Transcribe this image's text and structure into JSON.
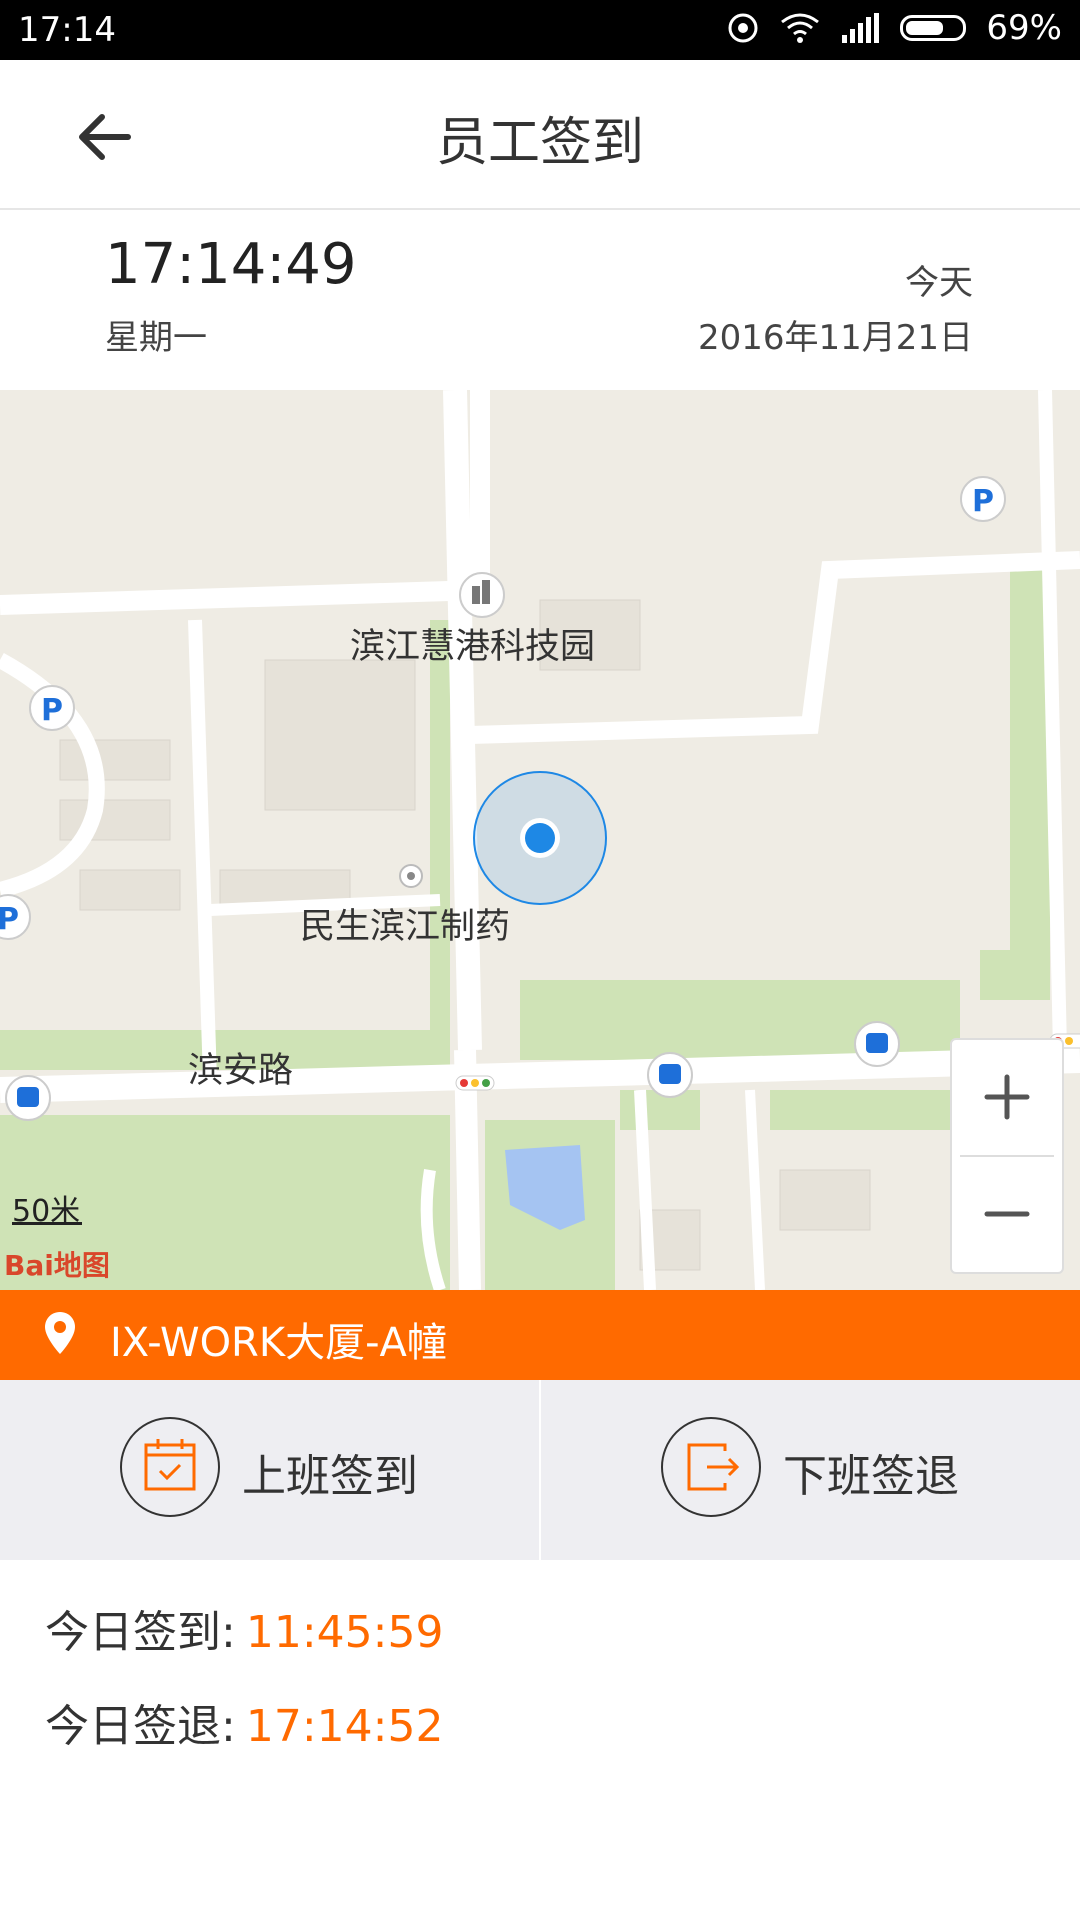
{
  "status_bar": {
    "time": "17:14",
    "battery": "69%",
    "battery_level": 0.69
  },
  "header": {
    "title": "员工签到",
    "back_icon": "arrow-left-icon"
  },
  "date_panel": {
    "clock": "17:14:49",
    "weekday": "星期一",
    "today_label": "今天",
    "date": "2016年11月21日"
  },
  "map": {
    "labels": {
      "tech_park": "滨江慧港科技园",
      "pharma": "民生滨江制药",
      "road": "滨安路"
    },
    "scale": "50米",
    "logo": "Bai地图",
    "zoom_in": "+",
    "zoom_out": "−",
    "colors": {
      "ground": "#efece4",
      "road": "#ffffff",
      "green": "#cfe3b6",
      "water": "#a5c4f2",
      "location": "#1e88e5"
    }
  },
  "location": {
    "name": "IX-WORK大厦-A幢",
    "icon": "map-pin-icon",
    "color": "#ff6a00"
  },
  "actions": {
    "check_in": {
      "label": "上班签到",
      "icon": "calendar-check-icon"
    },
    "check_out": {
      "label": "下班签退",
      "icon": "exit-icon"
    }
  },
  "records": {
    "check_in_label": "今日签到:",
    "check_in_time": "11:45:59",
    "check_out_label": "今日签退:",
    "check_out_time": "17:14:52"
  }
}
